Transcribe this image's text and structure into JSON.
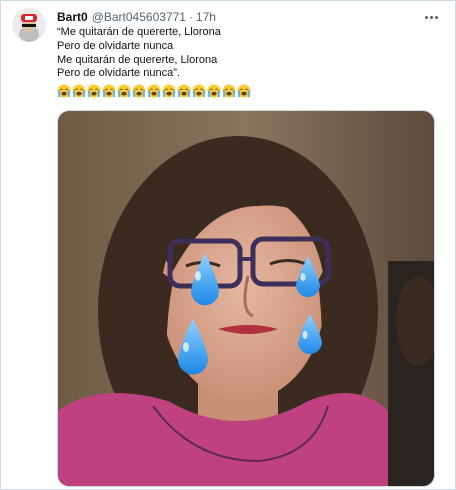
{
  "tweet": {
    "display_name": "Bart0",
    "handle": "@Bart045603771",
    "separator": "·",
    "time": "17h",
    "lines": [
      "“Me quitarán de quererte, Llorona",
      "Pero de olvidarte nunca",
      "Me quitarán de quererte, Llorona",
      "Pero de olvidarte nunca”."
    ],
    "emoji": "loudly-crying-face",
    "emoji_count": 13
  },
  "media": {
    "description_icon": "photo"
  },
  "colors": {
    "text_primary": "#0f1419",
    "text_secondary": "#536471",
    "border": "#cfd9de"
  }
}
